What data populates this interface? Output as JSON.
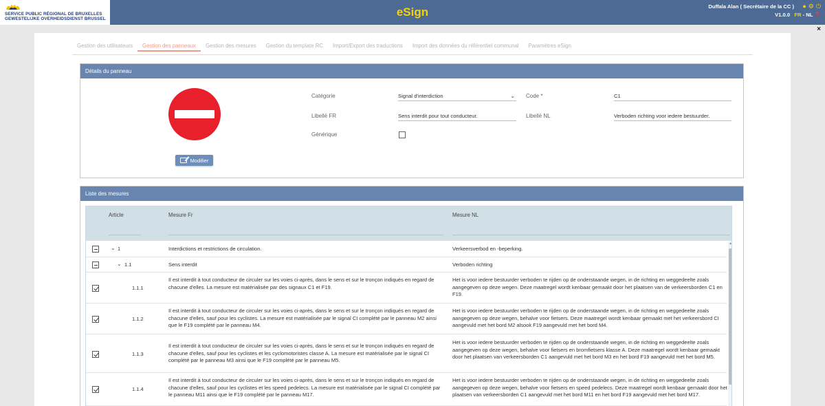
{
  "header": {
    "logo_line1": "SERVICE PUBLIC RÉGIONAL DE BRUXELLES",
    "logo_line2": "GEWESTELIJKE OVERHEIDSDIENST BRUSSEL",
    "app_title": "eSign",
    "user_name": "Duffala Alan",
    "user_role": "( Secrétaire de la CC )",
    "version": "V1.0.0",
    "lang_fr": "FR",
    "lang_sep": " - ",
    "lang_nl": "NL",
    "icons": [
      "user-icon",
      "gear-icon",
      "power-icon",
      "help-icon"
    ],
    "accent_color": "#f5d20a",
    "bar_color": "#4d6a94"
  },
  "close_label": "×",
  "tabs": [
    {
      "label": "Gestion des utilisateurs",
      "active": false
    },
    {
      "label": "Gestion des panneaux",
      "active": true
    },
    {
      "label": "Gestion des mesures",
      "active": false
    },
    {
      "label": "Gestion du template RC",
      "active": false
    },
    {
      "label": "Import/Export des traductions",
      "active": false
    },
    {
      "label": "Import des données du référentiel communal",
      "active": false
    },
    {
      "label": "Paramètres eSign",
      "active": false
    }
  ],
  "details": {
    "title": "Détails du panneau",
    "modify_label": "Modifier",
    "categorie_label": "Catégorie",
    "categorie_value": "Signal d'interdiction",
    "code_label": "Code *",
    "code_value": "C1",
    "libelle_fr_label": "Libellé FR",
    "libelle_fr_value": "Sens interdit pour tout conducteur.",
    "libelle_nl_label": "Libellé NL",
    "libelle_nl_value": "Verboden richting voor iedere bestuurder.",
    "generique_label": "Générique",
    "generique_checked": false,
    "sign_color": "#e8202b"
  },
  "list": {
    "title": "Liste des mesures",
    "columns": {
      "article": "Article",
      "mesure_fr": "Mesure Fr",
      "mesure_nl": "Mesure NL"
    },
    "rows": [
      {
        "article": "1",
        "check": "minus",
        "fr": "Interdictions et restrictions de circulation.",
        "nl": "Verkeersverbod en -beperking."
      },
      {
        "article": "1.1",
        "check": "minus",
        "fr": "Sens interdit",
        "nl": "Verboden richting"
      },
      {
        "article": "1.1.1",
        "check": "checked",
        "fr": "Il est interdit à tout conducteur de circuler sur les voies ci-après, dans le sens et sur le tronçon indiqués en regard de chacune d'elles. La mesure est matérialisée par des signaux C1 et F19.",
        "nl": "Het is voor iedere bestuurder verboden te rijden op de onderstaande wegen, in de richting en weggedeelte zoals aangegeven op deze wegen. Deze maatregel wordt kenbaar gemaakt door het plaatsen van de verkeersborden C1 en F19."
      },
      {
        "article": "1.1.2",
        "check": "checked",
        "fr": "Il est interdit à tout conducteur de circuler sur les voies ci-après, dans le sens et sur le tronçon indiqués en regard de chacune d'elles, sauf pour les cyclistes. La mesure est matérialisée par le signal CI complété par le panneau M2 ainsi que le F19 complété par le panneau M4.",
        "nl": "Het is voor iedere bestuurder verboden te rijden op de onderstaande wegen, in de richting en weggedeelte zoals aangegeven op deze wegen, behalve voor fietsers. Deze maatregel wordt kenbaar gemaakt met het verkeersbord CI aangevuld met het bord M2 alsook F19 aangevuld met het bord M4."
      },
      {
        "article": "1.1.3",
        "check": "checked",
        "fr": "Il est interdit à tout conducteur de circuler sur les voies ci-après, dans le sens et sur le tronçon indiqués en regard de chacune d'elles, sauf pour les cyclistes et les cyclomotoristes classe A. La mesure est matérialisée par le signal CI complété par le panneau M3 ainsi que le F19 complété par le panneau M5.",
        "nl": "Het is voor iedere bestuurder verboden te rijden op de onderstaande wegen, in de richting en weggedeelte zoals aangegeven op deze wegen, behalve voor fietsers en bromfietsers klasse A. Deze maatregel wordt kenbaar gemaakt door het plaatsen van verkeersborden C1 aangevuld met het bord M3 en het bord F19 aangevuld met het bord M5."
      },
      {
        "article": "1.1.4",
        "check": "checked",
        "fr": "Il est interdit à tout conducteur de circuler sur les voies ci-après, dans le sens et sur le tronçon indiqués en regard de chacune d'elles, sauf pour les cyclistes et les speed pedelecs. La mesure est matérialisée par le signal CI complété par le panneau M11 ainsi que le F19 complété par le panneau M17.",
        "nl": "Het is voor iedere bestuurder verboden te rijden op de onderstaande wegen, in de richting en weggedeelte zoals aangegeven op deze wegen, behalve voor fietsers en speed pedelecs. Deze maatregel wordt kenbaar gemaakt door het plaatsen van verkeersborden C1 aangevuld met het bord M11 en het bord F19 aangevuld met het bord M17."
      }
    ]
  }
}
